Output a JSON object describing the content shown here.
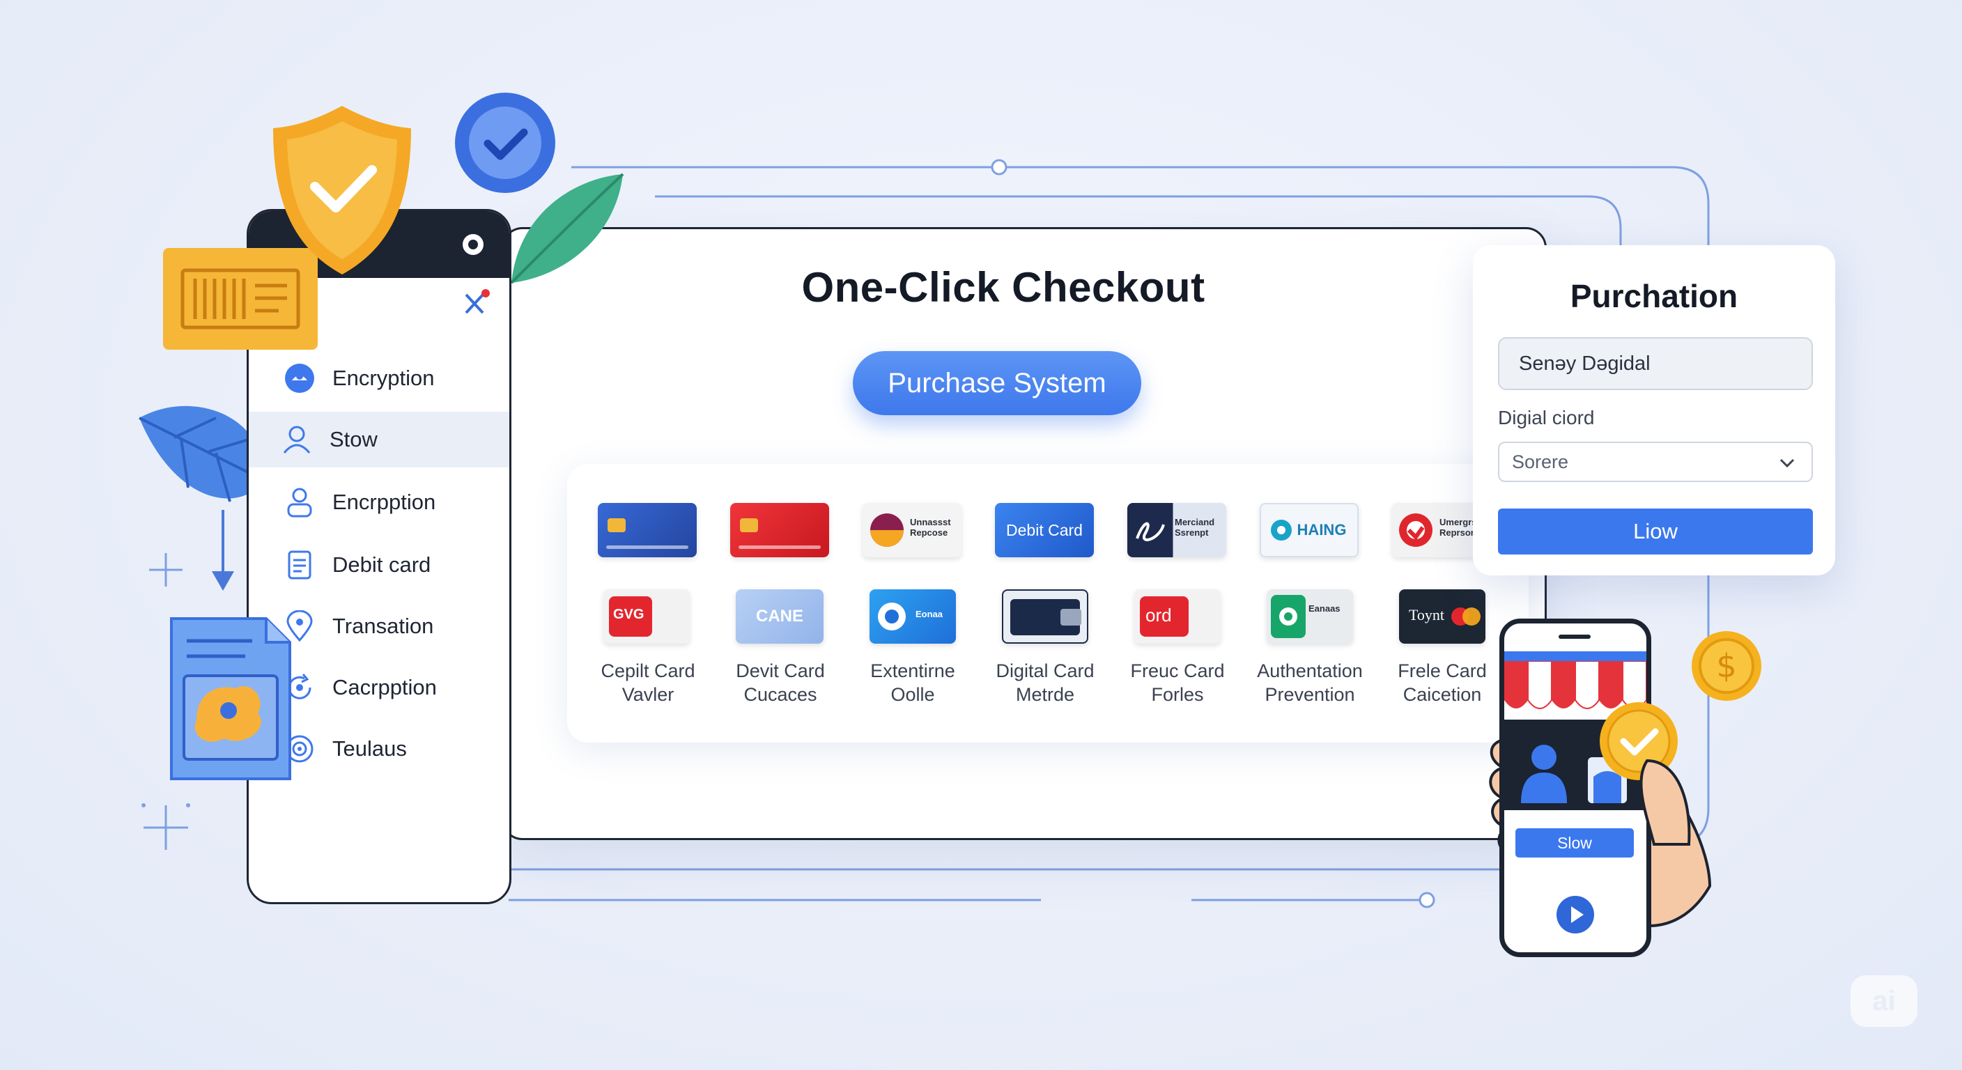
{
  "checkout": {
    "title": "One-Click Checkout",
    "primary_button": "Purchase System"
  },
  "sidebar": {
    "items": [
      {
        "label": "Encryption",
        "icon": "lock-icon",
        "active": false
      },
      {
        "label": "Stow",
        "icon": "user-icon",
        "active": true
      },
      {
        "label": "Encrpption",
        "icon": "person-icon",
        "active": false
      },
      {
        "label": "Debit card",
        "icon": "document-icon",
        "active": false
      },
      {
        "label": "Transation",
        "icon": "location-pin-icon",
        "active": false
      },
      {
        "label": "Cacrpption",
        "icon": "refresh-icon",
        "active": false
      },
      {
        "label": "Teulaus",
        "icon": "target-icon",
        "active": false
      }
    ]
  },
  "payment_methods": {
    "row1": [
      {
        "card_text": "",
        "color": "#2c57c6",
        "icon": "credit-card-icon"
      },
      {
        "card_text": "",
        "color": "#e8262c",
        "icon": "credit-card-icon"
      },
      {
        "card_text": "Unnassst Repcose",
        "color": "#f4f4f4",
        "icon": "circle-logo-icon"
      },
      {
        "card_text": "Debit Card",
        "color": "#2d6fe0",
        "icon": "debit-card-icon"
      },
      {
        "card_text": "Merciand Ssrenpt",
        "color": "#dfe6f2",
        "icon": "signature-icon"
      },
      {
        "card_text": "HAING",
        "color": "#f2f6fb",
        "icon": "badge-logo-icon"
      },
      {
        "card_text": "Umergrs Reprsort",
        "color": "#f2f2f2",
        "icon": "red-logo-icon"
      }
    ],
    "row2": [
      {
        "card_text": "GVG",
        "label": "Cepilt Card\nVavler",
        "color": "#f2f2f2",
        "icon": "red-chip-icon"
      },
      {
        "card_text": "CANE",
        "label": "Devit Card\nCucaces",
        "color": "#a7c3ee",
        "icon": "card-icon"
      },
      {
        "card_text": "Eonaa",
        "label": "Extentirne\nOolle",
        "color": "#2a8ee8",
        "icon": "wallet-icon"
      },
      {
        "card_text": "",
        "label": "Digital Card\nMetrde",
        "color": "#1c2a4a",
        "icon": "wallet-card-icon"
      },
      {
        "card_text": "ord",
        "label": "Freuc Card\nForles",
        "color": "#f2f2f2",
        "icon": "red-card-icon"
      },
      {
        "card_text": "Eanaas",
        "label": "Authentation\nPrevention",
        "color": "#e8ecef",
        "icon": "green-logo-icon"
      },
      {
        "card_text": "Toynt",
        "label": "Frele Card\nCaicetion",
        "color": "#1d2633",
        "icon": "mastercard-icon"
      }
    ]
  },
  "purchase_form": {
    "title": "Purchation",
    "input_value": "Senәy Dәgidal",
    "select_label": "Digial ciord",
    "select_value": "Sorere",
    "submit_label": "Liow"
  },
  "shop_phone": {
    "button_label": "Slow"
  },
  "watermark": "ai",
  "colors": {
    "accent": "#3b78ee",
    "shield": "#f4a825",
    "leaf": "#3fb08a",
    "coin": "#f5b21e",
    "awning_red": "#e5333b"
  }
}
